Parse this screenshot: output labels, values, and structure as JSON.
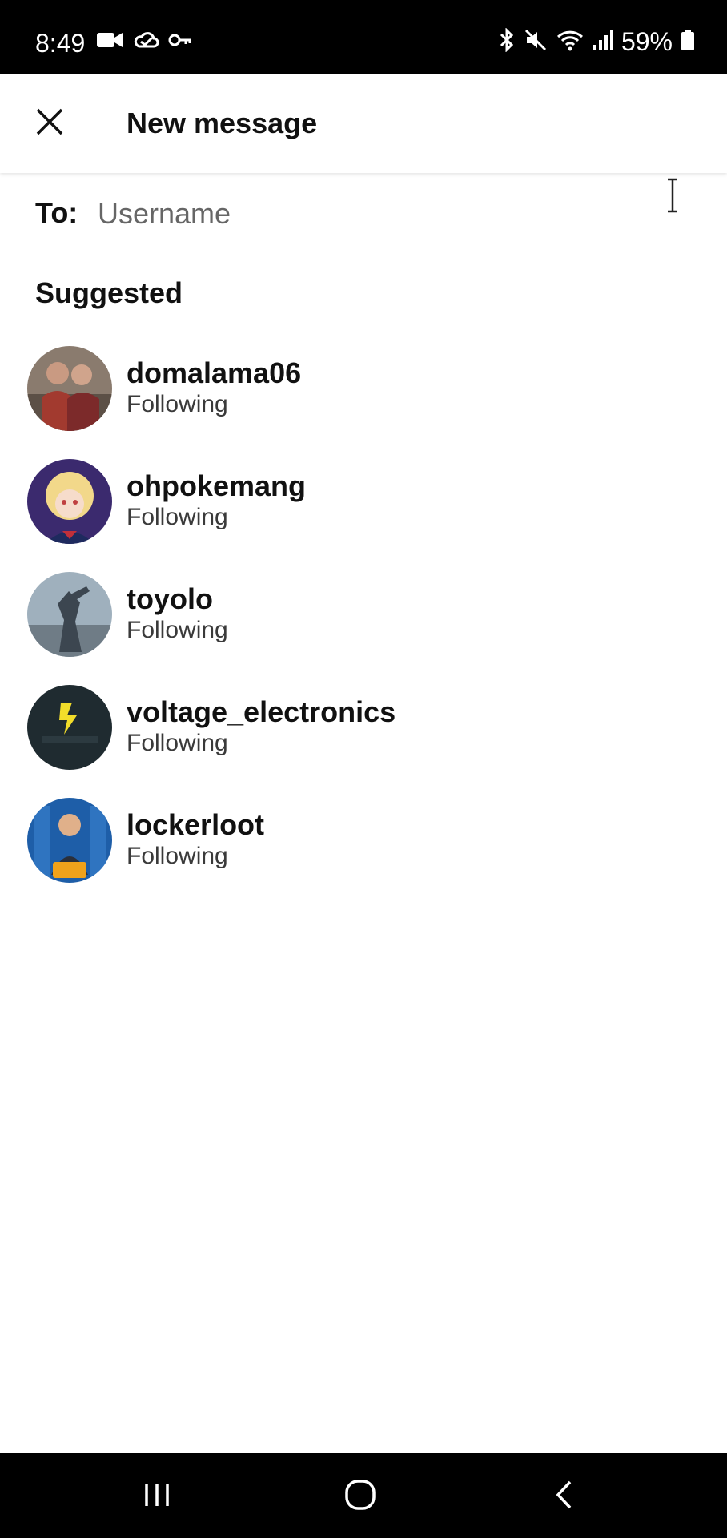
{
  "status_bar": {
    "time": "8:49",
    "battery": "59%",
    "left_icons": [
      "video-camera-icon",
      "cloud-icon",
      "key-icon"
    ],
    "right_icons": [
      "bluetooth-icon",
      "mute-icon",
      "wifi-icon",
      "signal-icon",
      "battery-icon"
    ]
  },
  "header": {
    "title": "New message",
    "close_icon": "close-icon"
  },
  "to_field": {
    "label": "To:",
    "placeholder": "Username",
    "value": ""
  },
  "suggested": {
    "title": "Suggested",
    "items": [
      {
        "username": "domalama06",
        "status": "Following",
        "avatar_colors": [
          "#7c6a5c",
          "#a23a2f"
        ]
      },
      {
        "username": "ohpokemang",
        "status": "Following",
        "avatar_colors": [
          "#3b2a6e",
          "#f2d88a"
        ]
      },
      {
        "username": "toyolo",
        "status": "Following",
        "avatar_colors": [
          "#9fb0bd",
          "#3c4650"
        ]
      },
      {
        "username": "voltage_electronics",
        "status": "Following",
        "avatar_colors": [
          "#1f2b30",
          "#f2dd2a"
        ]
      },
      {
        "username": "lockerloot",
        "status": "Following",
        "avatar_colors": [
          "#1e5ea8",
          "#f0a21b"
        ]
      }
    ]
  },
  "nav_bar": {
    "recents": "recents-icon",
    "home": "home-icon",
    "back": "back-icon"
  }
}
